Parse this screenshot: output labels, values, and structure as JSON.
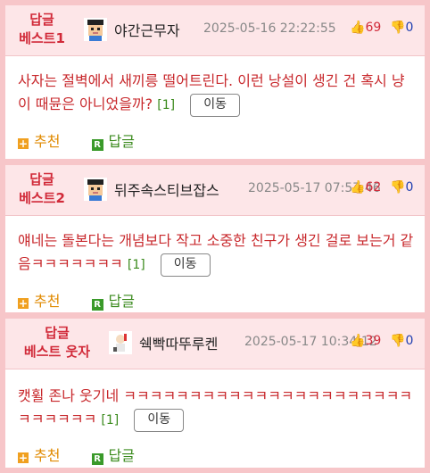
{
  "comments": [
    {
      "badge": [
        "답글",
        "베스트1"
      ],
      "nick": "야간근무자",
      "date": "2025-05-16 22:22:55",
      "up": "69",
      "down": "0",
      "text": "사자는 절벽에서 새끼릉 떨어트린다. 이런 낭설이 생긴 건 혹시 냥이 때뮨은 아니었을까?",
      "count": "[1]",
      "move": "이동",
      "recommend": "추천",
      "reply": "답글"
    },
    {
      "badge": [
        "답글",
        "베스트2"
      ],
      "nick": "뒤주속스티브잡스",
      "date": "2025-05-17 07:57:46",
      "up": "62",
      "down": "0",
      "text": "얘네는 돌본다는 개념보다 작고 소중한 친구가 생긴 걸로 보는거 같음ㅋㅋㅋㅋㅋㅋㅋ",
      "count": "[1]",
      "move": "이동",
      "recommend": "추천",
      "reply": "답글"
    },
    {
      "badge": [
        "답글",
        "베스트 웃자"
      ],
      "nick": "쉑빡따뚜루켄",
      "date": "2025-05-17 10:34:12",
      "up": "39",
      "down": "0",
      "text": "캣휠 존나 웃기네 ㅋㅋㅋㅋㅋㅋㅋㅋㅋㅋㅋㅋㅋㅋㅋㅋㅋㅋㅋㅋㅋㅋㅋㅋㅋㅋㅋㅋ",
      "count": "[1]",
      "move": "이동",
      "recommend": "추천",
      "reply": "답글"
    }
  ]
}
